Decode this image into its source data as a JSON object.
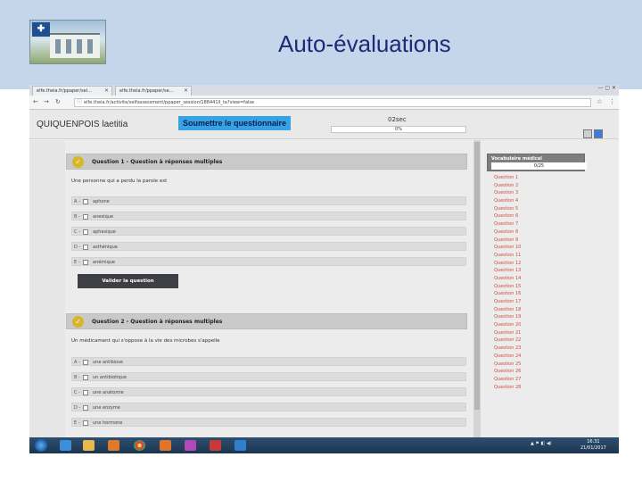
{
  "slide": {
    "title": "Auto-évaluations"
  },
  "browser": {
    "tabs": [
      {
        "label": "elfe.theia.fr/ppaper/sel..."
      },
      {
        "label": "elfe.theia.fr/ppaper/se..."
      }
    ],
    "url": "elfe.theia.fr/activite/selfassessment/ppaper_session/188441ll_ta?view=false",
    "window_controls": "— ▢ ✕"
  },
  "app": {
    "user_name": "QUIQUENPOIS laetitia",
    "submit_label": "Soumettre le questionnaire",
    "timer": "02sec",
    "progress": "0%",
    "progress_value": 0
  },
  "questions": [
    {
      "title": "Question 1 - Question à réponses multiples",
      "text": "Une personne qui a perdu la parole est",
      "options": [
        {
          "letter": "A -",
          "text": "aphone"
        },
        {
          "letter": "B -",
          "text": "anexique"
        },
        {
          "letter": "C -",
          "text": "aphasique"
        },
        {
          "letter": "D -",
          "text": "asthénique"
        },
        {
          "letter": "E -",
          "text": "anémique"
        }
      ],
      "validate_label": "Valider la question"
    },
    {
      "title": "Question 2 - Question à réponses multiples",
      "text": "Un médicament qui s'oppose à la vie des microbes s'appelle",
      "options": [
        {
          "letter": "A -",
          "text": "une antibiose"
        },
        {
          "letter": "B -",
          "text": "un antibiotique"
        },
        {
          "letter": "C -",
          "text": "une anatomie"
        },
        {
          "letter": "D -",
          "text": "une enzyme"
        },
        {
          "letter": "E -",
          "text": "une hormone"
        }
      ]
    }
  ],
  "sidebar": {
    "title": "Vocabulaire médical",
    "score": "0/25",
    "items": [
      "Question 1",
      "Question 2",
      "Question 3",
      "Question 4",
      "Question 5",
      "Question 6",
      "Question 7",
      "Question 8",
      "Question 9",
      "Question 10",
      "Question 11",
      "Question 12",
      "Question 13",
      "Question 14",
      "Question 15",
      "Question 16",
      "Question 17",
      "Question 18",
      "Question 19",
      "Question 20",
      "Question 21",
      "Question 22",
      "Question 23",
      "Question 24",
      "Question 25",
      "Question 26",
      "Question 27",
      "Question 28"
    ]
  },
  "taskbar": {
    "tray": "▲ ⚑ ◧ ◀)",
    "time": "16:31",
    "date": "21/01/2017"
  },
  "colors": {
    "slide_header_bg": "#c5d5ea",
    "title_color": "#1a2b78",
    "submit_bg": "#35a3e4",
    "question_badge": "#d8b62a",
    "sidebar_link": "#d24a3c"
  }
}
